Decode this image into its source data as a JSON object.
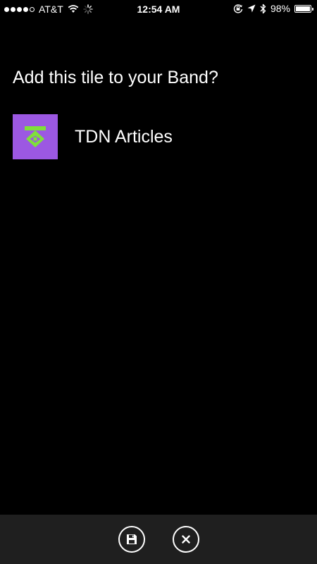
{
  "status_bar": {
    "carrier": "AT&T",
    "time": "12:54 AM",
    "battery_percent": "98%",
    "battery_level": 0.98,
    "signal_strength": {
      "filled": 4,
      "total": 5
    },
    "icons": [
      "signal-dots-icon",
      "wifi-icon",
      "activity-spinner-icon",
      "rotation-lock-icon",
      "location-arrow-icon",
      "bluetooth-icon",
      "battery-icon"
    ]
  },
  "dialog": {
    "title": "Add this tile to your Band?",
    "tile": {
      "name": "TDN Articles",
      "icon_bg_color": "#9c58e2",
      "icon_fg_color": "#7fe03a"
    }
  },
  "app_bar": {
    "background": "#1f1f1f",
    "buttons": [
      {
        "name": "save",
        "icon": "save-icon"
      },
      {
        "name": "cancel",
        "icon": "close-icon"
      }
    ]
  }
}
